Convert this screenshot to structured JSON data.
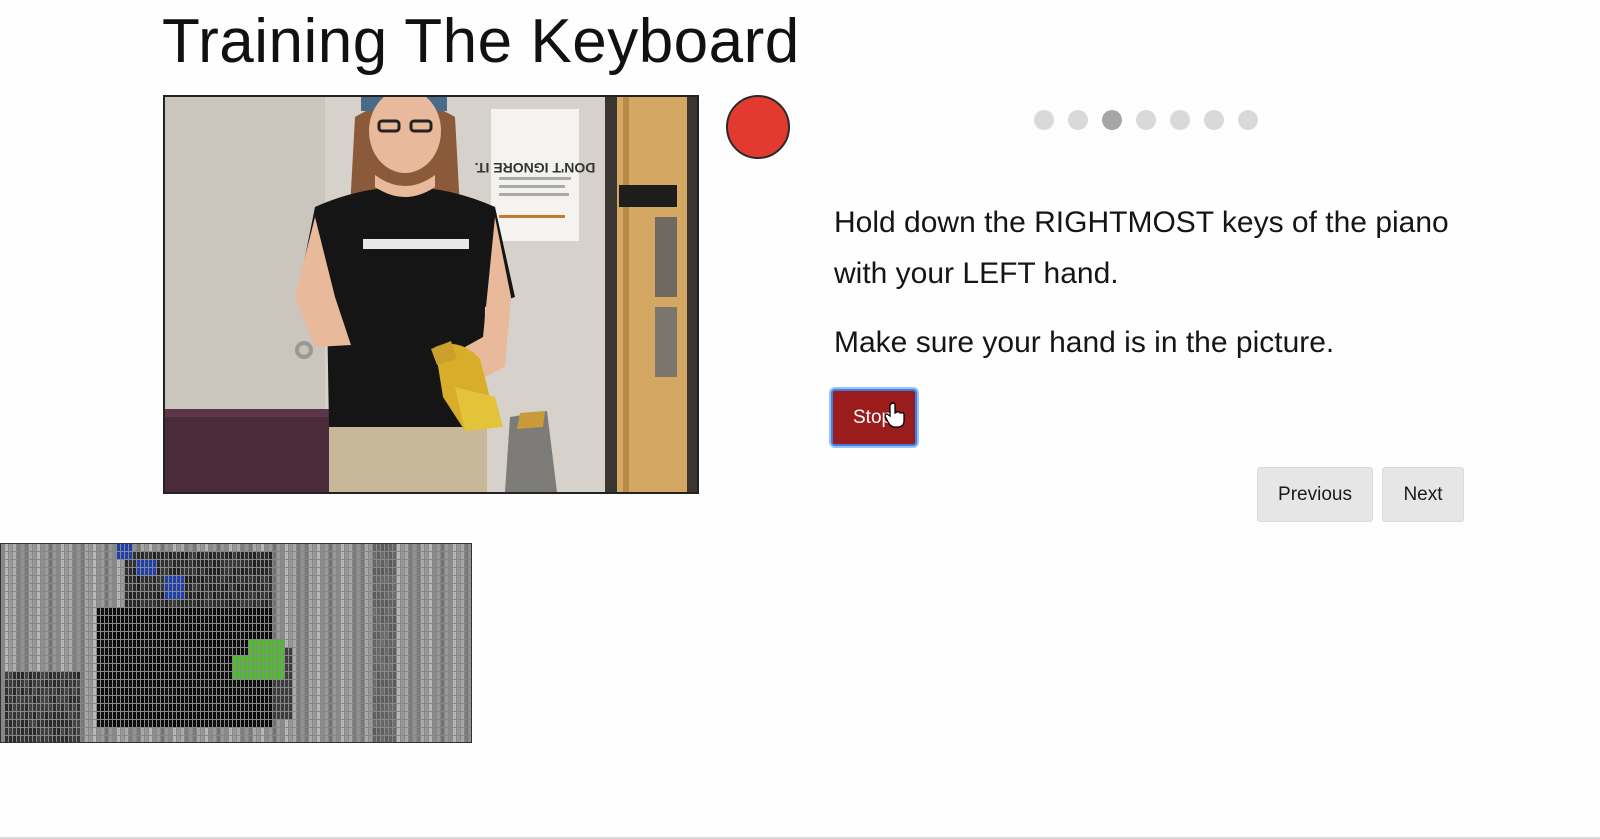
{
  "page": {
    "title": "Training The Keyboard"
  },
  "webcam": {
    "poster_text": "DON'T IGNORE IT."
  },
  "recording_indicator": {
    "color": "#e23a2f"
  },
  "progress": {
    "total_steps": 7,
    "current_step": 3
  },
  "instructions": {
    "line1": "Hold down the RIGHTMOST keys of the piano with your LEFT hand.",
    "line2": "Make sure your hand is in the picture."
  },
  "controls": {
    "stop_label": "Stop",
    "previous_label": "Previous",
    "next_label": "Next"
  },
  "colors": {
    "stop_button": "#9b1c1c",
    "focus_ring": "#3d7ee0",
    "highlight_blue": "#1f3fb0",
    "highlight_green": "#4cbf2a"
  }
}
